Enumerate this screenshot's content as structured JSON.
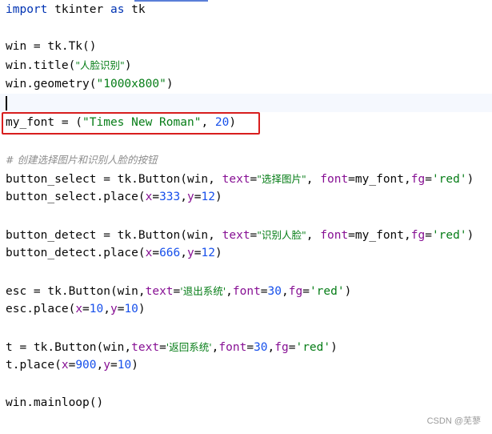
{
  "code": {
    "line1": {
      "kw": "import",
      "mid": " tkinter ",
      "kw2": "as",
      "tail": " tk"
    },
    "line3": {
      "text": "win = tk.Tk()"
    },
    "line4": {
      "pre": "win.title(",
      "str": "\"人脸识别\"",
      "post": ")"
    },
    "line5": {
      "pre": "win.geometry(",
      "str": "\"1000x800\"",
      "post": ")"
    },
    "line7": {
      "pre": "my_font = (",
      "str": "\"Times New Roman\"",
      "mid": ", ",
      "num": "20",
      "post": ")"
    },
    "line9": {
      "text": "# 创建选择图片和识别人脸的按钮"
    },
    "line10": {
      "pre": "button_select = tk.Button(win, ",
      "p1": "text",
      "eq1": "=",
      "s1": "\"选择图片\"",
      "c1": ", ",
      "p2": "font",
      "eq2": "=my_font,",
      "p3": "fg",
      "eq3": "=",
      "s3": "'red'",
      "post": ")"
    },
    "line11": {
      "pre": "button_select.place(",
      "p1": "x",
      "eq1": "=",
      "n1": "333",
      "c": ",",
      "p2": "y",
      "eq2": "=",
      "n2": "12",
      "post": ")"
    },
    "line13": {
      "pre": "button_detect = tk.Button(win, ",
      "p1": "text",
      "eq1": "=",
      "s1": "\"识别人脸\"",
      "c1": ", ",
      "p2": "font",
      "eq2": "=my_font,",
      "p3": "fg",
      "eq3": "=",
      "s3": "'red'",
      "post": ")"
    },
    "line14": {
      "pre": "button_detect.place(",
      "p1": "x",
      "eq1": "=",
      "n1": "666",
      "c": ",",
      "p2": "y",
      "eq2": "=",
      "n2": "12",
      "post": ")"
    },
    "line16": {
      "pre": "esc = tk.Button(win,",
      "p1": "text",
      "eq1": "=",
      "s1": "'退出系统'",
      "c1": ",",
      "p2": "font",
      "eq2": "=",
      "n2": "30",
      "c2": ",",
      "p3": "fg",
      "eq3": "=",
      "s3": "'red'",
      "post": ")"
    },
    "line17": {
      "pre": "esc.place(",
      "p1": "x",
      "eq1": "=",
      "n1": "10",
      "c": ",",
      "p2": "y",
      "eq2": "=",
      "n2": "10",
      "post": ")"
    },
    "line19": {
      "pre": "t = tk.Button(win,",
      "p1": "text",
      "eq1": "=",
      "s1": "'返回系统'",
      "c1": ",",
      "p2": "font",
      "eq2": "=",
      "n2": "30",
      "c2": ",",
      "p3": "fg",
      "eq3": "=",
      "s3": "'red'",
      "post": ")"
    },
    "line20": {
      "pre": "t.place(",
      "p1": "x",
      "eq1": "=",
      "n1": "900",
      "c": ",",
      "p2": "y",
      "eq2": "=",
      "n2": "10",
      "post": ")"
    },
    "line22": {
      "text": "win.mainloop()"
    }
  },
  "watermark": "CSDN @芜蓼",
  "colors": {
    "keyword": "#0033b3",
    "string": "#067d17",
    "number": "#1750eb",
    "parameter": "#871094",
    "comment": "#8c8c8c",
    "highlight_box": "#d81e1e"
  }
}
